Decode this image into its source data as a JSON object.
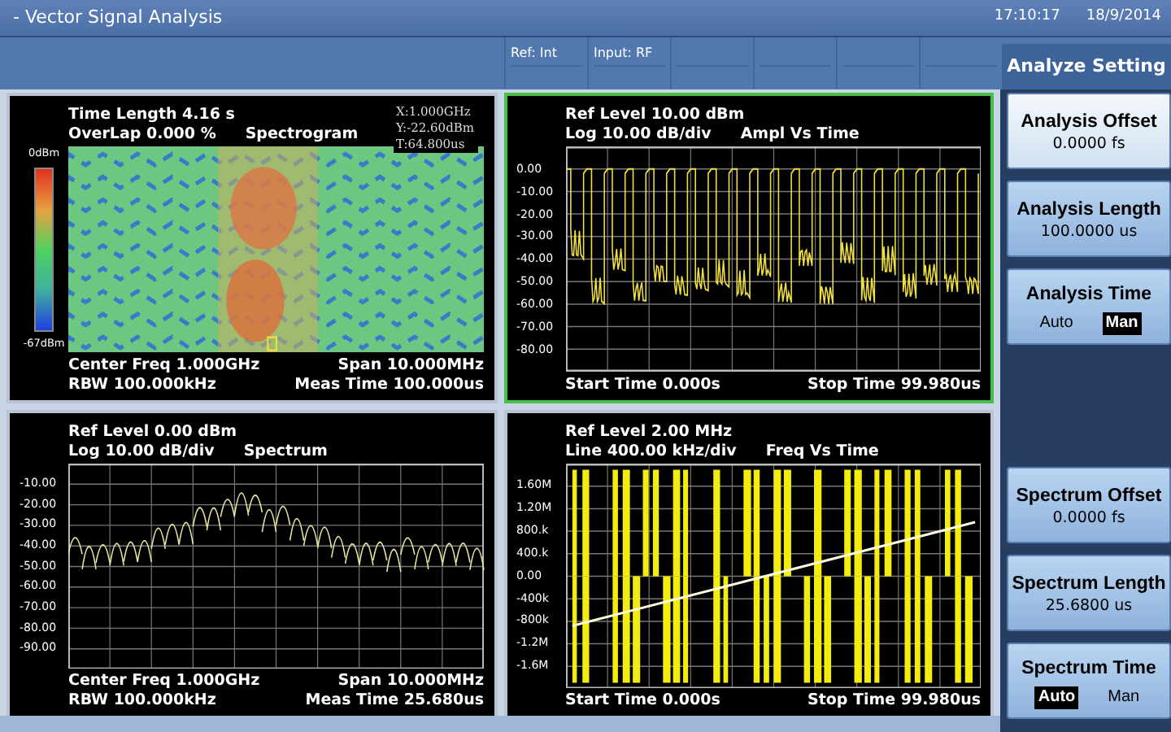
{
  "window": {
    "title": "- Vector Signal Analysis",
    "time": "17:10:17",
    "date": "18/9/2014"
  },
  "info_cells": [
    "Ref: Int",
    "Input: RF"
  ],
  "panels": [
    {
      "kind": "spectrogram",
      "selected": false,
      "header": [
        [
          "Time Length 4.16 s"
        ],
        [
          "OverLap 0.000 %",
          "Spectrogram"
        ]
      ],
      "marker": [
        "X:1.000GHz",
        "Y:-22.60dBm",
        "T:64.800us"
      ],
      "scale_top": "0dBm",
      "scale_bottom": "-67dBm",
      "footer": [
        [
          "Center Freq 1.000GHz",
          "Span 10.000MHz"
        ],
        [
          "RBW 100.000kHz",
          "Meas Time 100.000us"
        ]
      ]
    },
    {
      "kind": "ampl",
      "selected": true,
      "header": [
        [
          "Ref Level 10.00 dBm"
        ],
        [
          "Log 10.00 dB/div",
          "Ampl Vs Time"
        ]
      ],
      "y_labels": [
        "0.00",
        "-10.00",
        "-20.00",
        "-30.00",
        "-40.00",
        "-50.00",
        "-60.00",
        "-70.00",
        "-80.00"
      ],
      "footer": [
        [
          "Start Time 0.000s",
          "Stop Time 99.980us"
        ]
      ]
    },
    {
      "kind": "spectrum",
      "selected": false,
      "header": [
        [
          "Ref Level 0.00 dBm"
        ],
        [
          "Log 10.00 dB/div",
          "Spectrum"
        ]
      ],
      "y_labels": [
        "-10.00",
        "-20.00",
        "-30.00",
        "-40.00",
        "-50.00",
        "-60.00",
        "-70.00",
        "-80.00",
        "-90.00"
      ],
      "footer": [
        [
          "Center Freq 1.000GHz",
          "Span 10.000MHz"
        ],
        [
          "RBW 100.000kHz",
          "Meas Time 25.680us"
        ]
      ]
    },
    {
      "kind": "freq",
      "selected": false,
      "header": [
        [
          "Ref Level 2.00 MHz"
        ],
        [
          "Line 400.00 kHz/div",
          "Freq Vs Time"
        ]
      ],
      "y_labels": [
        "1.60M",
        "1.20M",
        "800.k",
        "400.k",
        "0.00",
        "-400k",
        "-800k",
        "-1.2M",
        "-1.6M"
      ],
      "footer": [
        [
          "Start Time 0.000s",
          "Stop Time 99.980us"
        ]
      ]
    }
  ],
  "menu_title": "Analyze Setting",
  "softkeys_top": [
    {
      "kind": "value",
      "label": "Analysis Offset",
      "value": "0.0000 fs",
      "selected": true
    },
    {
      "kind": "value",
      "label": "Analysis Length",
      "value": "100.0000 us",
      "selected": false
    },
    {
      "kind": "toggle",
      "label": "Analysis Time",
      "selected": false,
      "options": [
        {
          "label": "Auto",
          "selected": false
        },
        {
          "label": "Man",
          "selected": true
        }
      ]
    }
  ],
  "softkeys_bottom": [
    {
      "kind": "value",
      "label": "Spectrum Offset",
      "value": "0.0000 fs",
      "selected": false
    },
    {
      "kind": "value",
      "label": "Spectrum Length",
      "value": "25.6800 us",
      "selected": false
    },
    {
      "kind": "toggle",
      "label": "Spectrum Time",
      "selected": false,
      "options": [
        {
          "label": "Auto",
          "selected": true
        },
        {
          "label": "Man",
          "selected": false
        }
      ]
    }
  ]
}
